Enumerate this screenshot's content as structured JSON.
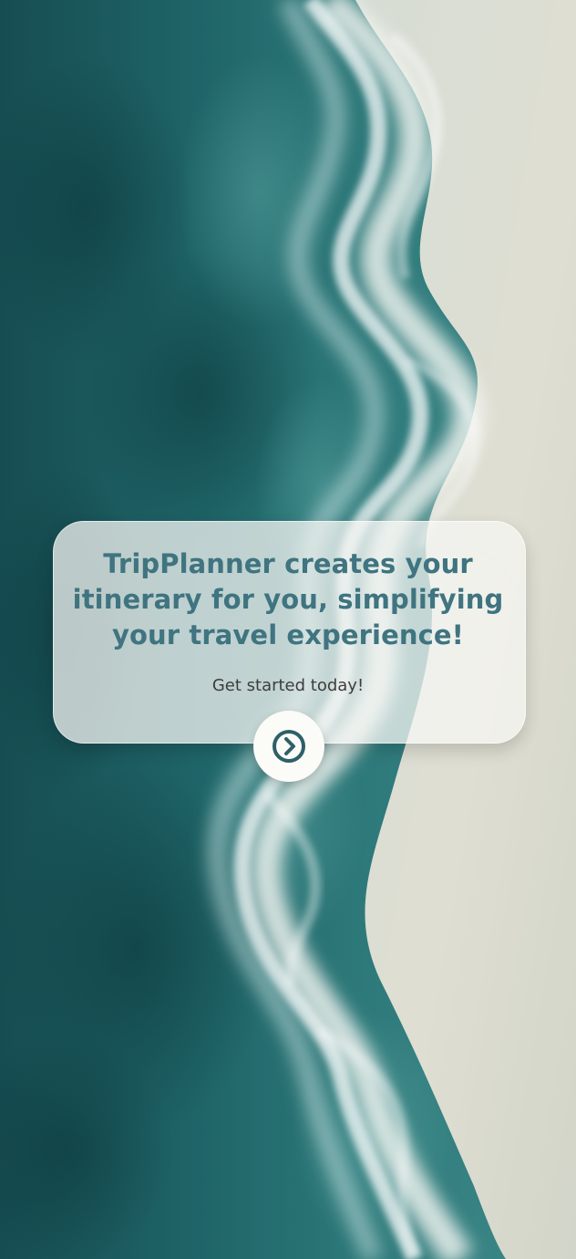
{
  "hero": {
    "headline": "TripPlanner creates your\nitinerary for you, simplifying\nyour travel experience!",
    "subtext": "Get started today!"
  },
  "actions": {
    "next_icon": "chevron-right-circle-icon"
  },
  "colors": {
    "ocean_dark": "#164b50",
    "ocean_mid": "#2c7478",
    "surf": "#f4f6f2",
    "sand": "#dedfd3",
    "headline": "#3f7480",
    "card_background": "#f7f7f4",
    "button_background": "#fbfbf8",
    "icon": "#2f5f69"
  }
}
